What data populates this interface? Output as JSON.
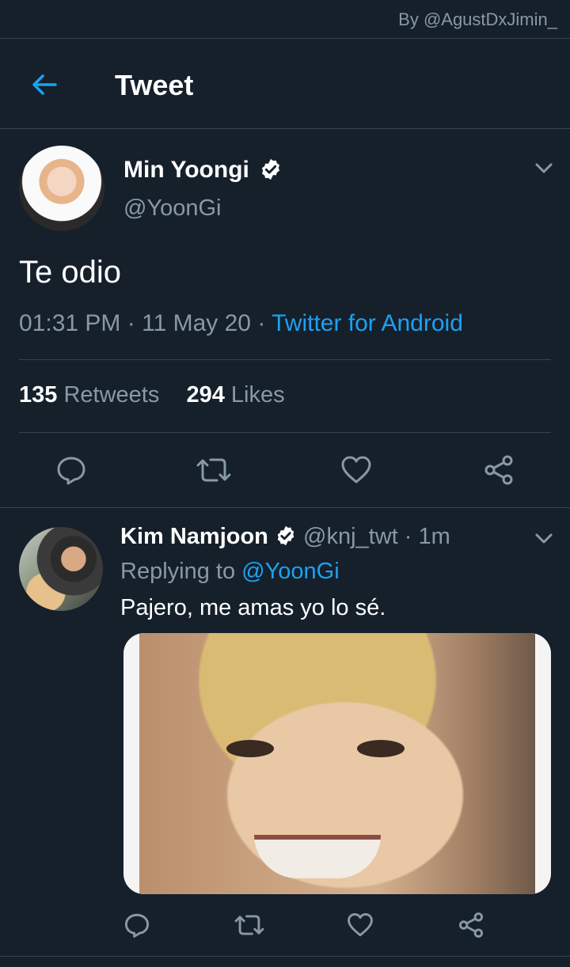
{
  "watermark": "By @AgustDxJimin_",
  "header": {
    "title": "Tweet",
    "back_icon": "arrow-left-icon"
  },
  "tweet": {
    "author_name": "Min Yoongi",
    "author_handle": "@YoonGi",
    "text": "Te odio",
    "time": "01:31 PM",
    "date": "11 May 20",
    "source": "Twitter for Android",
    "retweets_count": "135",
    "retweets_label": "Retweets",
    "likes_count": "294",
    "likes_label": "Likes"
  },
  "reply": {
    "author_name": "Kim Namjoon",
    "author_handle": "@knj_twt",
    "time_ago": "1m",
    "replying_prefix": "Replying to",
    "replying_to": "@YoonGi",
    "text": "Pajero, me amas yo lo sé."
  },
  "colors": {
    "background": "#15202b",
    "accent": "#1da1f2",
    "secondary_text": "#8899a6",
    "divider": "#38444d"
  }
}
